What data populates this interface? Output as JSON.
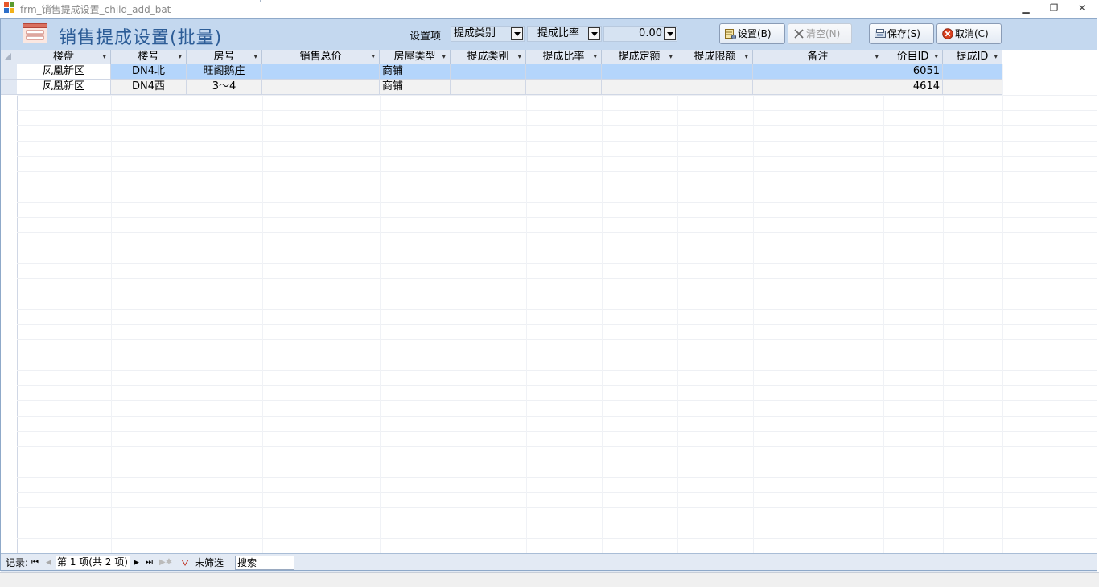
{
  "window": {
    "title": "frm_销售提成设置_child_add_bat",
    "minimize": "▁",
    "restore": "❐",
    "close": "✕"
  },
  "header": {
    "title": "销售提成设置(批量)",
    "setting_label": "设置项",
    "setting_type_value": "提成类别",
    "setting_field_value": "提成比率",
    "setting_amount_value": "0.00",
    "buttons": {
      "set": "设置(B)",
      "clear": "清空(N)",
      "save": "保存(S)",
      "cancel": "取消(C)"
    }
  },
  "columns": [
    "楼盘",
    "楼号",
    "房号",
    "销售总价",
    "房屋类型",
    "提成类别",
    "提成比率",
    "提成定额",
    "提成限额",
    "备注",
    "价目ID",
    "提成ID"
  ],
  "rows": [
    [
      "凤凰新区",
      "DN4北",
      "旺阁鹅庄",
      "",
      "商铺",
      "",
      "",
      "",
      "",
      "",
      "6051",
      ""
    ],
    [
      "凤凰新区",
      "DN4西",
      "3～4",
      "",
      "商铺",
      "",
      "",
      "",
      "",
      "",
      "4614",
      ""
    ]
  ],
  "navigator": {
    "record_label": "记录:",
    "position": "第 1 项(共 2 项)",
    "filter_status": "未筛选",
    "search_label": "搜索"
  },
  "colors": {
    "header_bg": "#c4d8ef",
    "title_color": "#2d5d97",
    "selected_row": "#b4d5fb"
  }
}
